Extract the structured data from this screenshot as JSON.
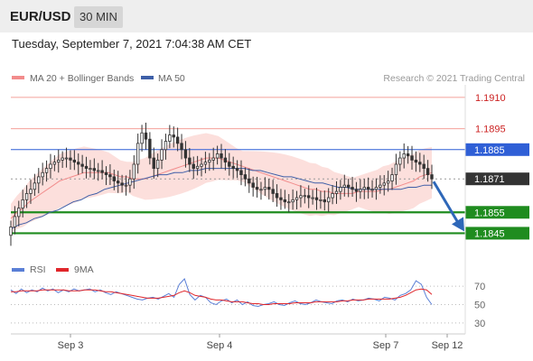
{
  "header": {
    "symbol": "EUR/USD",
    "interval": "30 MIN"
  },
  "timestamp": "Tuesday, September 7, 2021 7:04:38 AM CET",
  "legend": {
    "items": [
      {
        "label": "MA 20 + Bollinger Bands",
        "color": "#f28c8c"
      },
      {
        "label": "MA 50",
        "color": "#3e5fa8"
      }
    ],
    "credit": "Research © 2021 Trading Central"
  },
  "rsi_legend": {
    "items": [
      {
        "label": "RSI",
        "color": "#5a7fd6"
      },
      {
        "label": "9MA",
        "color": "#e0262b"
      }
    ]
  },
  "colors": {
    "resistance": "#f4a09a",
    "pivot": "#2f5fd6",
    "support": "#1f8c1f",
    "current": "#333333",
    "arrow": "#2e67b8",
    "band": "#fbd9d6",
    "ma20": "#f28c8c",
    "ma50": "#3e5fa8",
    "candle": "#333333"
  },
  "chart_data": [
    {
      "type": "candlestick",
      "xlabel": "",
      "ylabel": "",
      "x_ticks": [
        "Sep 3",
        "Sep 4",
        "Sep 7",
        "Sep 12"
      ],
      "ylim": [
        1.184,
        1.1916
      ],
      "grid": false,
      "legend_placement": "top-left",
      "levels": [
        {
          "label": "1.1910",
          "value": 1.191,
          "kind": "resistance"
        },
        {
          "label": "1.1895",
          "value": 1.1895,
          "kind": "resistance"
        },
        {
          "label": "1.1885",
          "value": 1.1885,
          "kind": "pivot"
        },
        {
          "label": "1.1871",
          "value": 1.1871,
          "kind": "current"
        },
        {
          "label": "1.1855",
          "value": 1.1855,
          "kind": "support"
        },
        {
          "label": "1.1845",
          "value": 1.1845,
          "kind": "support"
        }
      ],
      "close": [
        1.1848,
        1.1853,
        1.1857,
        1.1861,
        1.1864,
        1.1866,
        1.1869,
        1.1872,
        1.1874,
        1.1876,
        1.1878,
        1.1879,
        1.188,
        1.1881,
        1.1881,
        1.188,
        1.1879,
        1.1878,
        1.1877,
        1.1876,
        1.1876,
        1.1875,
        1.1875,
        1.1874,
        1.1873,
        1.1872,
        1.187,
        1.1869,
        1.1868,
        1.1868,
        1.1871,
        1.1878,
        1.1888,
        1.1893,
        1.189,
        1.1881,
        1.1876,
        1.188,
        1.1885,
        1.1889,
        1.1892,
        1.1891,
        1.1888,
        1.1885,
        1.1881,
        1.1878,
        1.1876,
        1.1877,
        1.1878,
        1.1879,
        1.188,
        1.1881,
        1.1883,
        1.1881,
        1.1879,
        1.1877,
        1.1876,
        1.1875,
        1.1873,
        1.1871,
        1.1869,
        1.1867,
        1.1866,
        1.1866,
        1.1867,
        1.1866,
        1.1864,
        1.1862,
        1.1861,
        1.186,
        1.186,
        1.1861,
        1.1862,
        1.1863,
        1.1863,
        1.1862,
        1.1862,
        1.1861,
        1.1861,
        1.186,
        1.1862,
        1.1864,
        1.1865,
        1.1867,
        1.1868,
        1.1867,
        1.1866,
        1.1865,
        1.1866,
        1.1867,
        1.1866,
        1.1866,
        1.1867,
        1.1868,
        1.1869,
        1.187,
        1.1873,
        1.1878,
        1.1881,
        1.1883,
        1.1882,
        1.188,
        1.1879,
        1.1878,
        1.1876,
        1.1873,
        1.1871
      ],
      "ma20": [
        1.1852,
        1.1855,
        1.1857,
        1.186,
        1.1862,
        1.1864,
        1.1866,
        1.1868,
        1.187,
        1.1871,
        1.1872,
        1.1873,
        1.1874,
        1.1874,
        1.1874,
        1.1874,
        1.1874,
        1.1873,
        1.1872,
        1.1872,
        1.1871,
        1.1871,
        1.1871,
        1.1872,
        1.1873,
        1.1874,
        1.1875,
        1.1876,
        1.1877,
        1.1878,
        1.1879,
        1.188,
        1.1881,
        1.1881,
        1.1881,
        1.188,
        1.1879,
        1.1878,
        1.1877,
        1.1876,
        1.1875,
        1.1874,
        1.1873,
        1.1872,
        1.1871,
        1.187,
        1.1869,
        1.1868,
        1.1867,
        1.1866,
        1.1866,
        1.1865,
        1.1865,
        1.1864,
        1.1864,
        1.1864,
        1.1864,
        1.1865,
        1.1865,
        1.1865,
        1.1865,
        1.1866,
        1.1866,
        1.1867,
        1.1868,
        1.1869,
        1.187,
        1.1872,
        1.1873,
        1.1874
      ],
      "ma50": [
        1.1847,
        1.1849,
        1.185,
        1.1852,
        1.1853,
        1.1855,
        1.1856,
        1.1858,
        1.186,
        1.1861,
        1.1863,
        1.1864,
        1.1866,
        1.1867,
        1.1868,
        1.1869,
        1.187,
        1.1871,
        1.1872,
        1.1873,
        1.1873,
        1.1874,
        1.1874,
        1.1875,
        1.1875,
        1.1876,
        1.1876,
        1.1876,
        1.1876,
        1.1876,
        1.1876,
        1.1875,
        1.1875,
        1.1874,
        1.1873,
        1.1872,
        1.1872,
        1.1871,
        1.187,
        1.1869,
        1.1869,
        1.1868,
        1.1867,
        1.1867,
        1.1866,
        1.1866,
        1.1866,
        1.1866,
        1.1866,
        1.1866,
        1.1866,
        1.1867,
        1.1867,
        1.1868,
        1.1868
      ],
      "forecast": {
        "from": 1.1871,
        "to": 1.1845
      }
    },
    {
      "type": "line",
      "x_ticks": [
        "Sep 3",
        "Sep 4",
        "Sep 7",
        "Sep 12"
      ],
      "ylim": [
        20,
        80
      ],
      "y_ticks": [
        "70",
        "50",
        "30"
      ],
      "series": [
        {
          "name": "RSI",
          "values": [
            66,
            62,
            67,
            63,
            66,
            64,
            68,
            65,
            67,
            63,
            66,
            64,
            67,
            65,
            66,
            67,
            64,
            66,
            63,
            61,
            64,
            62,
            60,
            58,
            56,
            55,
            57,
            58,
            56,
            59,
            62,
            58,
            72,
            78,
            61,
            55,
            60,
            58,
            52,
            50,
            54,
            56,
            52,
            55,
            50,
            53,
            49,
            48,
            50,
            51,
            53,
            50,
            49,
            52,
            54,
            51,
            50,
            52,
            55,
            53,
            52,
            51,
            54,
            55,
            53,
            56,
            54,
            55,
            57,
            56,
            54,
            58,
            57,
            55,
            60,
            62,
            66,
            76,
            72,
            58,
            50
          ]
        },
        {
          "name": "9MA",
          "values": [
            64,
            64,
            65,
            65,
            65,
            65,
            66,
            66,
            66,
            66,
            66,
            65,
            65,
            65,
            66,
            66,
            66,
            65,
            64,
            64,
            63,
            62,
            61,
            60,
            59,
            58,
            57,
            57,
            57,
            58,
            59,
            60,
            63,
            65,
            63,
            60,
            59,
            58,
            56,
            55,
            55,
            54,
            53,
            53,
            53,
            52,
            51,
            51,
            50,
            50,
            51,
            51,
            51,
            51,
            52,
            52,
            52,
            52,
            53,
            53,
            53,
            53,
            53,
            54,
            54,
            55,
            55,
            55,
            56,
            56,
            56,
            56,
            56,
            57,
            58,
            60,
            63,
            66,
            67,
            66,
            61
          ]
        }
      ]
    }
  ]
}
